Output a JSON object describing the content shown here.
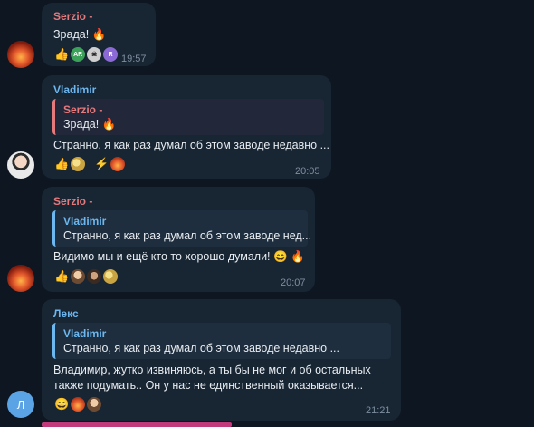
{
  "messages": [
    {
      "sender": "Serzio -",
      "text": "Зрада! 🔥",
      "reactions": [
        "👍",
        "AR",
        "💀",
        "R"
      ],
      "time": "19:57"
    },
    {
      "sender": "Vladimir",
      "quote_sender": "Serzio -",
      "quote_text": "Зрада! 🔥",
      "text": "Странно, я как раз думал об этом заводе недавно ...",
      "reactions": [
        "👍",
        "🪙",
        "⚡",
        "🔥"
      ],
      "time": "20:05"
    },
    {
      "sender": "Serzio -",
      "quote_sender": "Vladimir",
      "quote_text": "Странно, я как раз думал об этом заводе нед...",
      "text": "Видимо мы и ещё кто то хорошо думали! 😄 🔥",
      "reactions": [
        "👍"
      ],
      "time": "20:07"
    },
    {
      "sender": "Лекс",
      "quote_sender": "Vladimir",
      "quote_text": "Странно, я как раз думал об этом заводе недавно ...",
      "text_line1": "Владимир, жутко извиняюсь, а ты бы не мог и об остальных",
      "text_line2": "также подумать.. Он у нас не единственный оказывается...",
      "reactions": [
        "😄"
      ],
      "time": "21:21",
      "avatar_letter": "Л"
    }
  ],
  "colors": {
    "background": "#0e1621",
    "bubble": "#182533",
    "name_red": "#e5797b",
    "name_blue": "#6cb7ef",
    "time": "#7d8e9f"
  }
}
